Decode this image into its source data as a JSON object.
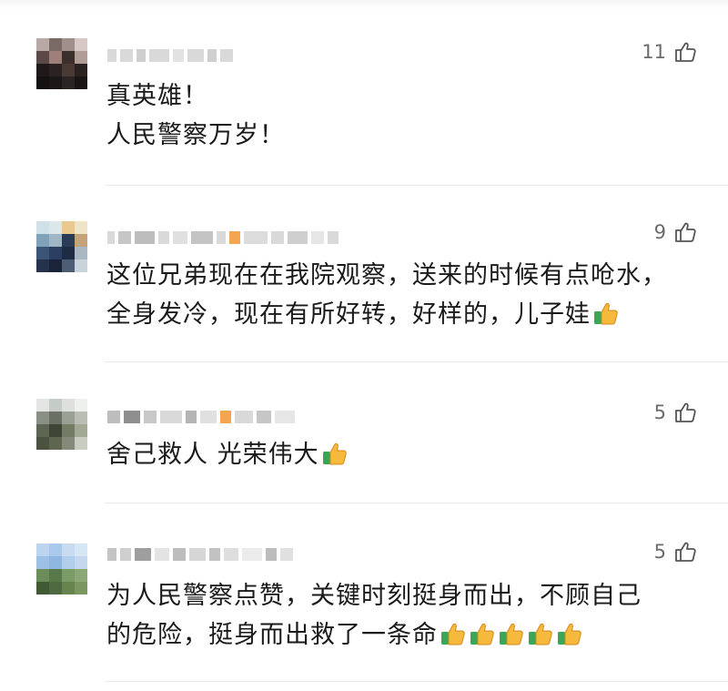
{
  "comments": [
    {
      "likes": "11",
      "lines": [
        "真英雄！",
        "人民警察万岁！"
      ],
      "emojis": 0
    },
    {
      "likes": "9",
      "lines": [
        "这位兄弟现在在我院观察，送来的时候有点呛水，",
        "全身发冷，现在有所好转，好样的，儿子娃"
      ],
      "emojis": 1
    },
    {
      "likes": "5",
      "lines": [
        "舍己救人 光荣伟大"
      ],
      "emojis": 1
    },
    {
      "likes": "5",
      "lines": [
        "为人民警察点赞，关键时刻挺身而出，不顾自己",
        "的危险，挺身而出救了一条命"
      ],
      "emojis": 5
    }
  ],
  "icons": {
    "like": "thumbs-up-outline-icon",
    "emoji": "thumbs-up-emoji-icon"
  },
  "colors": {
    "text": "#1a1a1a",
    "likes": "#6b6b6b",
    "divider": "#e8e8e8",
    "emoji_hand": "#f6b93b",
    "emoji_cuff": "#3aa655"
  }
}
